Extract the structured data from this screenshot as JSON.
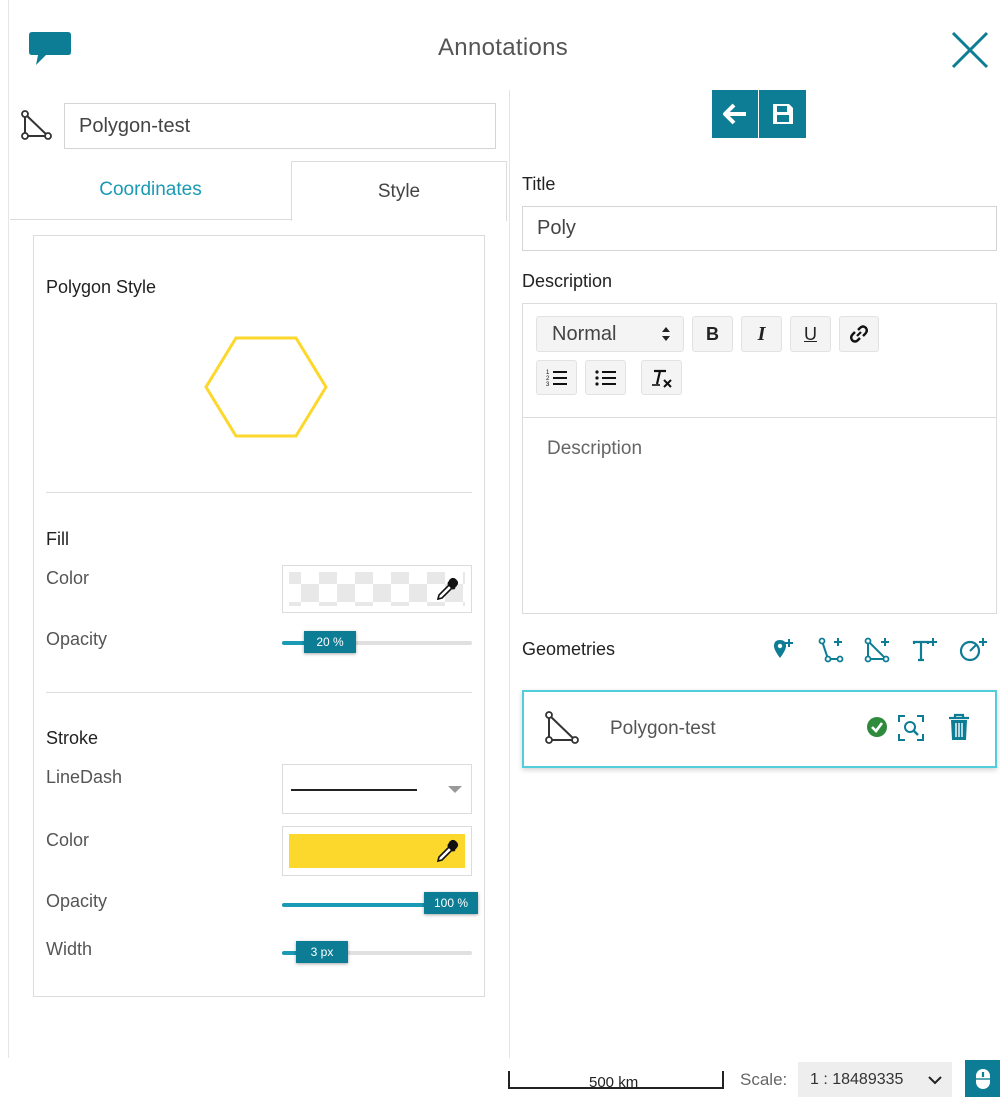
{
  "header": {
    "title": "Annotations"
  },
  "left": {
    "name_value": "Polygon-test",
    "tabs": [
      {
        "label": "Coordinates",
        "active": false
      },
      {
        "label": "Style",
        "active": true
      }
    ],
    "style_panel": {
      "heading": "Polygon Style",
      "preview_color": "#fcd72c",
      "fill": {
        "title": "Fill",
        "color_label": "Color",
        "opacity_label": "Opacity",
        "opacity_value": "20 %",
        "opacity_fraction": 0.2
      },
      "stroke": {
        "title": "Stroke",
        "linedash_label": "LineDash",
        "color_label": "Color",
        "color_value": "#fcd72c",
        "opacity_label": "Opacity",
        "opacity_value": "100 %",
        "opacity_fraction": 1.0,
        "width_label": "Width",
        "width_value": "3 px",
        "width_fraction": 0.12
      }
    }
  },
  "right": {
    "title_label": "Title",
    "title_value": "Poly",
    "description_label": "Description",
    "editor": {
      "format_select": "Normal",
      "placeholder": "Description",
      "buttons": [
        "B",
        "I",
        "U"
      ]
    },
    "geometries_label": "Geometries",
    "geometry_item": {
      "name": "Polygon-test"
    }
  },
  "footer": {
    "scale_bar_label": "500 km",
    "scale_label": "Scale:",
    "scale_value": "1 : 18489335"
  },
  "colors": {
    "accent": "#0d7d95",
    "tab_link": "#1a9ab5",
    "highlight_border": "#52cddb",
    "check": "#2e8b3c"
  }
}
